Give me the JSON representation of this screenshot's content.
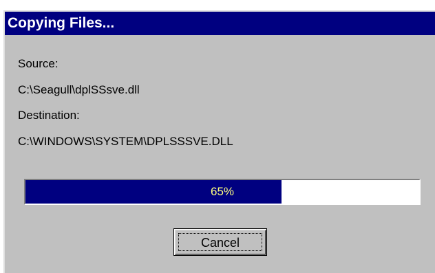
{
  "window": {
    "title": "Copying Files..."
  },
  "source": {
    "label": "Source:",
    "path": "C:\\Seagull\\dplSSsve.dll"
  },
  "destination": {
    "label": "Destination:",
    "path": "C:\\WINDOWS\\SYSTEM\\DPLSSSVE.DLL"
  },
  "progress": {
    "percent": 65,
    "text": "65%"
  },
  "buttons": {
    "cancel_label": "Cancel"
  },
  "colors": {
    "titlebar": "#000080",
    "progress_fill": "#000080",
    "dialog_face": "#c0c0c0"
  }
}
